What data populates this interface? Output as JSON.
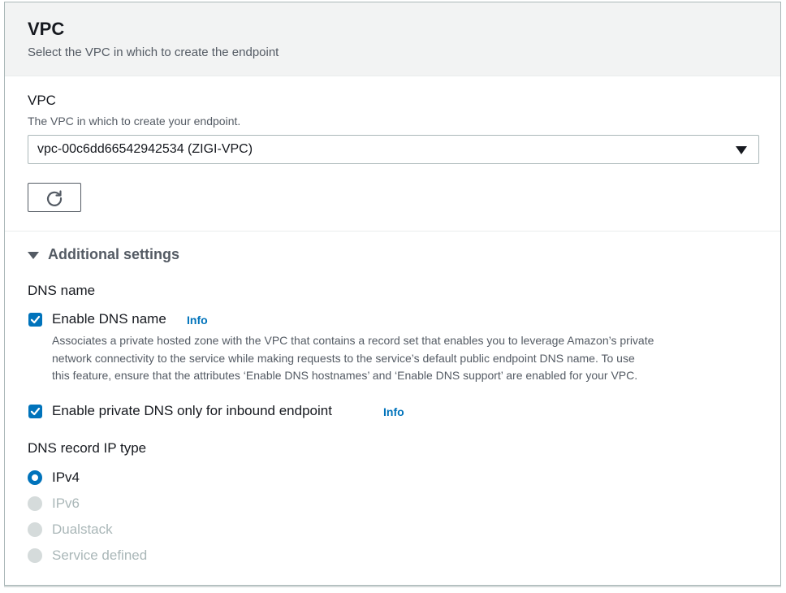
{
  "panel": {
    "title": "VPC",
    "description": "Select the VPC in which to create the endpoint"
  },
  "vpc_field": {
    "label": "VPC",
    "description": "The VPC in which to create your endpoint.",
    "selected_value": "vpc-00c6dd66542942534 (ZIGI-VPC)"
  },
  "refresh_button": {
    "icon": "refresh-icon"
  },
  "additional_settings": {
    "label": "Additional settings",
    "expanded": true
  },
  "dns_name": {
    "group_label": "DNS name",
    "enable_dns": {
      "label": "Enable DNS name",
      "checked": true,
      "info": "Info",
      "help_lines": [
        "Associates a private hosted zone with the VPC that contains a record set that enables you to leverage Amazon’s private",
        "network connectivity to the service while making requests to the service’s default public endpoint DNS name. To use",
        "this feature, ensure that the attributes ‘Enable DNS hostnames’ and ‘Enable DNS support’ are enabled for your VPC."
      ]
    },
    "private_dns_inbound": {
      "label": "Enable private DNS only for inbound endpoint",
      "checked": true,
      "info": "Info"
    }
  },
  "dns_record_ip_type": {
    "label": "DNS record IP type",
    "options": [
      {
        "label": "IPv4",
        "selected": true,
        "disabled": false
      },
      {
        "label": "IPv6",
        "selected": false,
        "disabled": true
      },
      {
        "label": "Dualstack",
        "selected": false,
        "disabled": true
      },
      {
        "label": "Service defined",
        "selected": false,
        "disabled": true
      }
    ]
  },
  "colors": {
    "accent": "#0073bb",
    "header_bg": "#f2f3f3",
    "border": "#aab7b8",
    "text": "#16191f",
    "muted_text": "#545b64",
    "disabled_text": "#aab7b8"
  }
}
